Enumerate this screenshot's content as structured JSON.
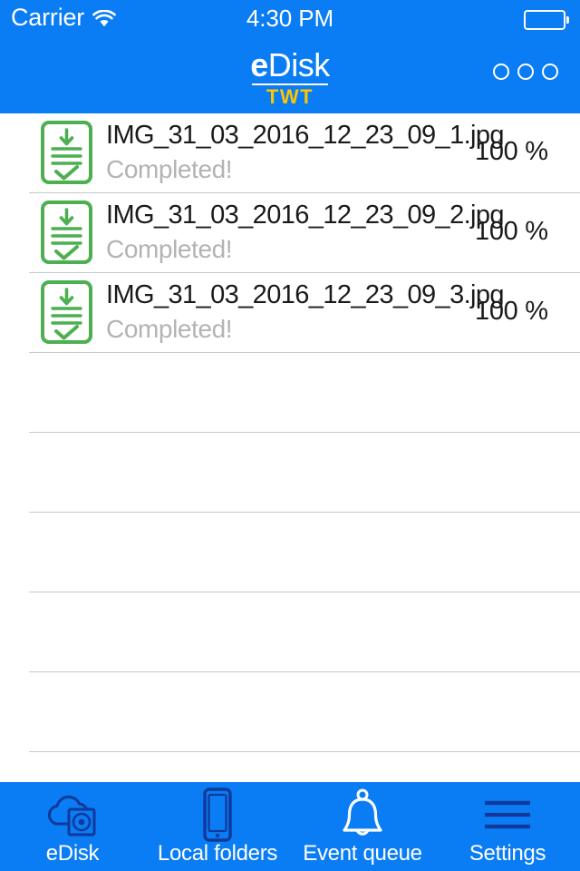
{
  "status_bar": {
    "carrier": "Carrier",
    "wifi_icon": "wifi-icon",
    "time": "4:30 PM",
    "battery_icon": "battery-icon"
  },
  "header": {
    "logo_primary_bold": "e",
    "logo_primary_light": "Disk",
    "logo_secondary": "TWT",
    "menu_icon": "more-options-icon",
    "background_color": "#0a7cf4",
    "accent_color": "#fdc500"
  },
  "list": {
    "items": [
      {
        "icon": "download-completed-document-icon",
        "file_name": "IMG_31_03_2016_12_23_09_1.jpg",
        "status": "Completed!",
        "percent_label": "100 %",
        "percent_value": 100
      },
      {
        "icon": "download-completed-document-icon",
        "file_name": "IMG_31_03_2016_12_23_09_2.jpg",
        "status": "Completed!",
        "percent_label": "100 %",
        "percent_value": 100
      },
      {
        "icon": "download-completed-document-icon",
        "file_name": "IMG_31_03_2016_12_23_09_3.jpg",
        "status": "Completed!",
        "percent_label": "100 %",
        "percent_value": 100
      }
    ],
    "empty_row_count": 5,
    "progress_color": "#1b7fe0",
    "icon_color": "#4caf50",
    "status_text_color": "#b3b3b3",
    "separator_color": "#c8c8c8"
  },
  "tab_bar": {
    "background_color": "#0a7cf4",
    "inactive_icon_color": "#10399b",
    "active_icon_color": "#ffffff",
    "tabs": [
      {
        "label": "eDisk",
        "icon": "cloud-disk-icon",
        "active": false
      },
      {
        "label": "Local folders",
        "icon": "mobile-device-icon",
        "active": false
      },
      {
        "label": "Event queue",
        "icon": "bell-icon",
        "active": true
      },
      {
        "label": "Settings",
        "icon": "hamburger-menu-icon",
        "active": false
      }
    ]
  }
}
